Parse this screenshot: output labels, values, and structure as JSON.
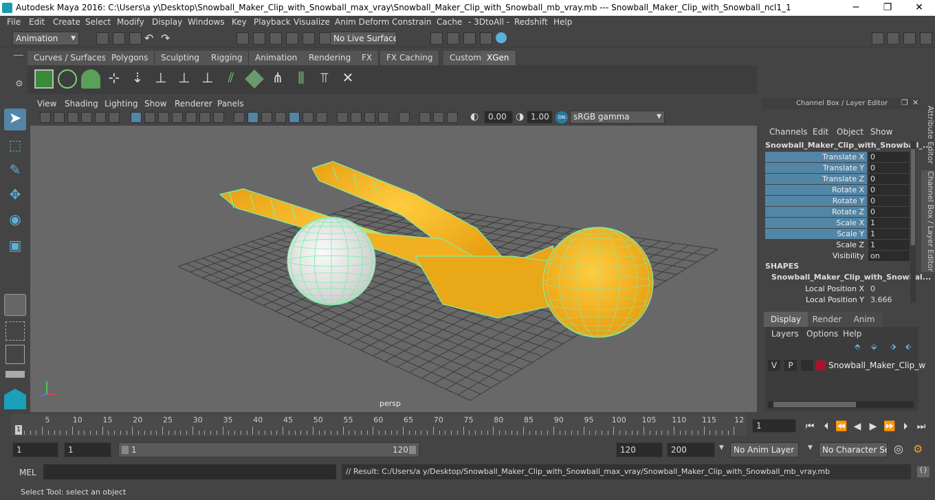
{
  "titlebar": {
    "title": "Autodesk Maya 2016: C:\\Users\\a y\\Desktop\\Snowball_Maker_Clip_with_Snowball_max_vray\\Snowball_Maker_Clip_with_Snowball_mb_vray.mb   ---   Snowball_Maker_Clip_with_Snowball_ncl1_1",
    "minimize": "─",
    "maximize": "❐",
    "close": "✕"
  },
  "menubar": [
    "File",
    "Edit",
    "Create",
    "Select",
    "Modify",
    "Display",
    "Windows",
    "Key",
    "Playback",
    "Visualize",
    "Anim Deform",
    "Constrain",
    "Cache",
    "- 3DtoAll -",
    "Redshift",
    "Help"
  ],
  "statusline": {
    "menuset": "Animation",
    "live_surface": "No Live Surface"
  },
  "shelf": {
    "tabs": [
      "Curves / Surfaces",
      "Polygons",
      "Sculpting",
      "Rigging",
      "Animation",
      "Rendering",
      "FX",
      "FX Caching",
      "Custom",
      "XGen"
    ],
    "active_tab": "XGen"
  },
  "viewport": {
    "menus": [
      "View",
      "Shading",
      "Lighting",
      "Show",
      "Renderer",
      "Panels"
    ],
    "exposure": "0.00",
    "gamma": "1.00",
    "color_space": "sRGB gamma",
    "camera_label": "persp"
  },
  "channelbox": {
    "header": "Channel Box / Layer Editor",
    "menus": [
      "Channels",
      "Edit",
      "Object",
      "Show"
    ],
    "object_name": "Snowball_Maker_Clip_with_Snowball_...",
    "channels": [
      {
        "label": "Translate X",
        "value": "0",
        "highlight": true
      },
      {
        "label": "Translate Y",
        "value": "0",
        "highlight": true
      },
      {
        "label": "Translate Z",
        "value": "0",
        "highlight": true
      },
      {
        "label": "Rotate X",
        "value": "0",
        "highlight": true
      },
      {
        "label": "Rotate Y",
        "value": "0",
        "highlight": true
      },
      {
        "label": "Rotate Z",
        "value": "0",
        "highlight": true
      },
      {
        "label": "Scale X",
        "value": "1",
        "highlight": true
      },
      {
        "label": "Scale Y",
        "value": "1",
        "highlight": true
      },
      {
        "label": "Scale Z",
        "value": "1",
        "highlight": false
      },
      {
        "label": "Visibility",
        "value": "on",
        "highlight": false
      }
    ],
    "shapes_header": "SHAPES",
    "shape_name": "Snowball_Maker_Clip_with_Snowbal...",
    "shape_channels": [
      {
        "label": "Local Position X",
        "value": "0"
      },
      {
        "label": "Local Position Y",
        "value": "3.666"
      }
    ]
  },
  "layereditor": {
    "tabs": [
      "Display",
      "Render",
      "Anim"
    ],
    "active_tab": "Display",
    "menus": [
      "Layers",
      "Options",
      "Help"
    ],
    "layer": {
      "v": "V",
      "p": "P",
      "name": "Snowball_Maker_Clip_w",
      "color": "#b0102c"
    }
  },
  "sidetabs": {
    "attribute_editor": "Attribute Editor",
    "channel_box": "Channel Box / Layer Editor"
  },
  "timeslider": {
    "ticks": [
      "5",
      "10",
      "15",
      "20",
      "25",
      "30",
      "35",
      "40",
      "45",
      "50",
      "55",
      "60",
      "65",
      "70",
      "75",
      "80",
      "85",
      "90",
      "95",
      "100",
      "105",
      "110",
      "115",
      "12"
    ],
    "current_label": "1",
    "current_frame": "1"
  },
  "range": {
    "start": "1",
    "playback_start": "1",
    "slider_start": "1",
    "slider_end": "120",
    "playback_end": "120",
    "end": "200",
    "anim_layer": "No Anim Layer",
    "character_set": "No Character Set"
  },
  "mel": {
    "label": "MEL",
    "result": "// Result: C:/Users/a y/Desktop/Snowball_Maker_Clip_with_Snowball_max_vray/Snowball_Maker_Clip_with_Snowball_mb_vray.mb"
  },
  "helpline": "Select Tool: select an object",
  "colors": {
    "wire": "#7df0a8",
    "object": "#f0b020",
    "highlight": "#5285a6"
  }
}
